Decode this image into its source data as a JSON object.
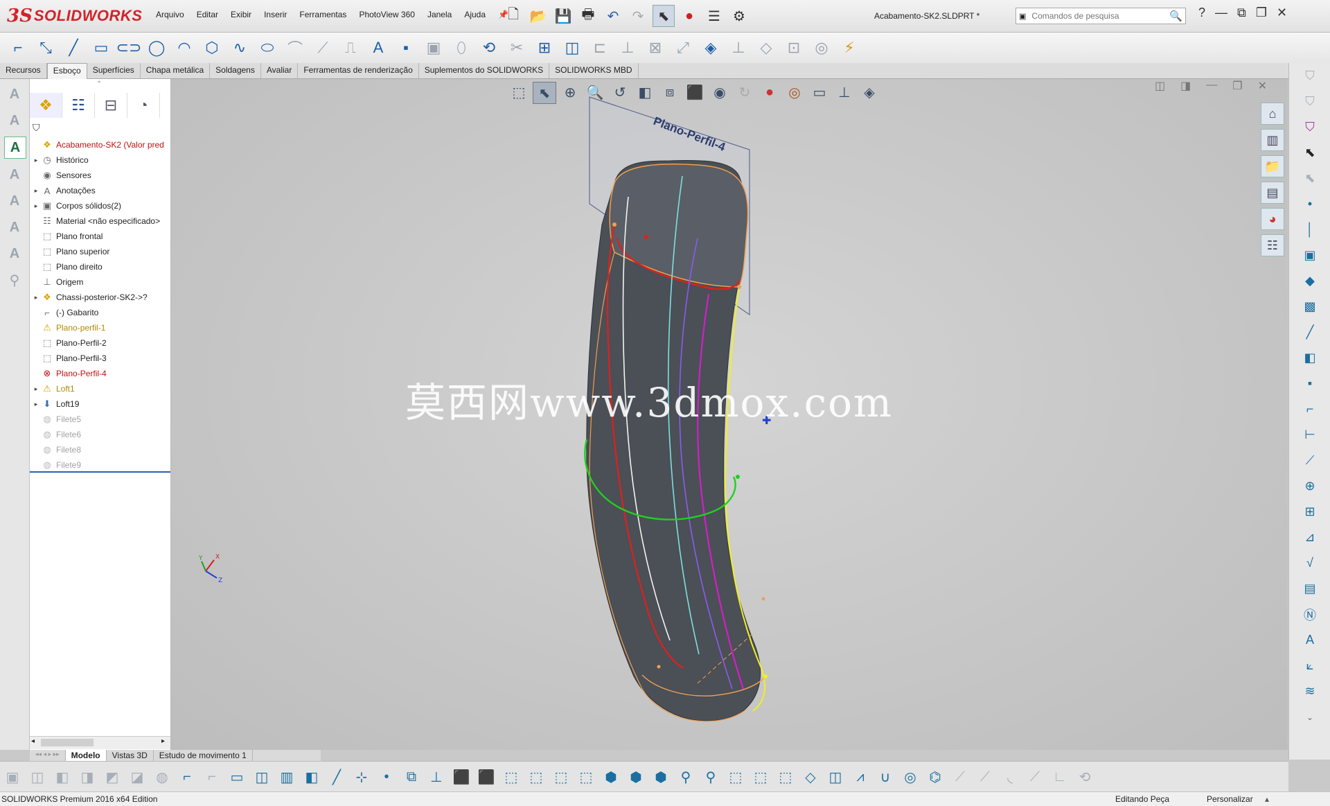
{
  "app": {
    "logo_ds": "3S",
    "logo_text": "SOLIDWORKS",
    "file_title": "Acabamento-SK2.SLDPRT *"
  },
  "menu": [
    "Arquivo",
    "Editar",
    "Exibir",
    "Inserir",
    "Ferramentas",
    "PhotoView 360",
    "Janela",
    "Ajuda"
  ],
  "search": {
    "placeholder": "Comandos de pesquisa"
  },
  "tabs": [
    {
      "label": "Recursos",
      "active": false
    },
    {
      "label": "Esboço",
      "active": true
    },
    {
      "label": "Superfícies",
      "active": false
    },
    {
      "label": "Chapa metálica",
      "active": false
    },
    {
      "label": "Soldagens",
      "active": false
    },
    {
      "label": "Avaliar",
      "active": false
    },
    {
      "label": "Ferramentas de renderização",
      "active": false
    },
    {
      "label": "Suplementos do SOLIDWORKS",
      "active": false
    },
    {
      "label": "SOLIDWORKS MBD",
      "active": false
    }
  ],
  "tree": [
    {
      "label": "Acabamento-SK2  (Valor pred",
      "state": "root",
      "exp": "",
      "icon": "part-icon"
    },
    {
      "label": "Histórico",
      "state": "normal",
      "exp": "▸",
      "icon": "history-icon"
    },
    {
      "label": "Sensores",
      "state": "normal",
      "exp": "",
      "icon": "sensor-icon"
    },
    {
      "label": "Anotações",
      "state": "normal",
      "exp": "▸",
      "icon": "annotation-icon"
    },
    {
      "label": "Corpos sólidos(2)",
      "state": "normal",
      "exp": "▸",
      "icon": "solid-bodies-icon"
    },
    {
      "label": "Material <não especificado>",
      "state": "normal",
      "exp": "",
      "icon": "material-icon"
    },
    {
      "label": "Plano frontal",
      "state": "normal",
      "exp": "",
      "icon": "plane-icon"
    },
    {
      "label": "Plano superior",
      "state": "normal",
      "exp": "",
      "icon": "plane-icon"
    },
    {
      "label": "Plano direito",
      "state": "normal",
      "exp": "",
      "icon": "plane-icon"
    },
    {
      "label": "Origem",
      "state": "normal",
      "exp": "",
      "icon": "origin-icon"
    },
    {
      "label": "Chassi-posterior-SK2->?",
      "state": "normal",
      "exp": "▸",
      "icon": "part-ref-icon"
    },
    {
      "label": "(-) Gabarito",
      "state": "normal",
      "exp": "",
      "icon": "sketch-icon"
    },
    {
      "label": "Plano-perfil-1",
      "state": "warn",
      "exp": "",
      "icon": "warning-icon"
    },
    {
      "label": "Plano-Perfil-2",
      "state": "normal",
      "exp": "",
      "icon": "plane-icon"
    },
    {
      "label": "Plano-Perfil-3",
      "state": "normal",
      "exp": "",
      "icon": "plane-icon"
    },
    {
      "label": "Plano-Perfil-4",
      "state": "err",
      "exp": "",
      "icon": "error-icon"
    },
    {
      "label": "Loft1",
      "state": "warn",
      "exp": "▸",
      "icon": "warning-icon"
    },
    {
      "label": "Loft19",
      "state": "normal",
      "exp": "▸",
      "icon": "loft-icon"
    },
    {
      "label": "Filete5",
      "state": "dim",
      "exp": "",
      "icon": "fillet-icon"
    },
    {
      "label": "Filete6",
      "state": "dim",
      "exp": "",
      "icon": "fillet-icon"
    },
    {
      "label": "Filete8",
      "state": "dim",
      "exp": "",
      "icon": "fillet-icon"
    },
    {
      "label": "Filete9",
      "state": "dim",
      "exp": "",
      "icon": "fillet-icon"
    }
  ],
  "bottom_tabs": [
    {
      "label": "Modelo",
      "active": true
    },
    {
      "label": "Vistas 3D",
      "active": false
    },
    {
      "label": "Estudo de movimento 1",
      "active": false
    }
  ],
  "viewport": {
    "plane_label": "Plano-Perfil-4",
    "watermark": "莫西网www.3dmox.com",
    "triad_x": "X",
    "triad_y": "Y",
    "triad_z": "Z"
  },
  "status": {
    "edition": "SOLIDWORKS Premium 2016 x64 Edition",
    "mode": "Editando Peça",
    "customize": "Personalizar"
  },
  "colors": {
    "red_curve": "#e0201c",
    "cyan_curve": "#7fe0e0",
    "purple_curve": "#8a5cf0",
    "magenta_curve": "#d020c8",
    "green_curve": "#20d020",
    "yellow_edge": "#f0f020",
    "orange_edge": "#f0a050",
    "body": "#4a4e55"
  }
}
